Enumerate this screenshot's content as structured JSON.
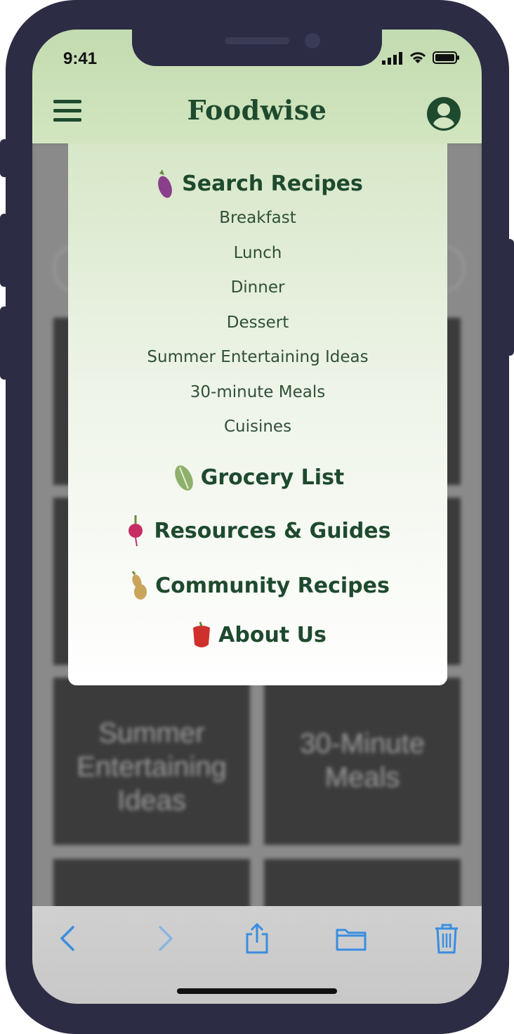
{
  "status": {
    "time": "9:41"
  },
  "header": {
    "title": "Foodwise"
  },
  "menu": {
    "search": {
      "label": "Search Recipes",
      "items": [
        "Breakfast",
        "Lunch",
        "Dinner",
        "Dessert",
        "Summer Entertaining Ideas",
        "30-minute Meals",
        "Cuisines"
      ]
    },
    "sections": [
      "Grocery List",
      "Resources & Guides",
      "Community Recipes",
      "About Us"
    ]
  },
  "background_tiles": {
    "summer": "Summer Entertaining Ideas",
    "meals": "30-Minute Meals"
  },
  "icons": {
    "search": "eggplant-icon",
    "grocery": "cabbage-icon",
    "resources": "radish-icon",
    "community": "squash-icon",
    "about": "bell-pepper-icon"
  },
  "colors": {
    "brand": "#1e4a2e",
    "header": "#c9dfb6",
    "frame": "#2c2d44",
    "toolbar_icons": "#3a8de0"
  }
}
